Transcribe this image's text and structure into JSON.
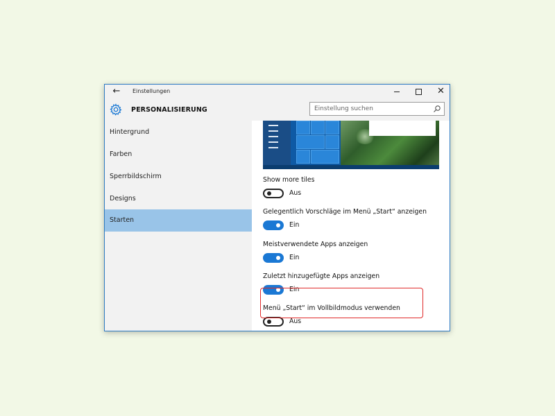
{
  "window": {
    "title": "Einstellungen"
  },
  "header": {
    "section_title": "PERSONALISIERUNG",
    "search_placeholder": "Einstellung suchen"
  },
  "sidebar": {
    "items": [
      {
        "label": "Hintergrund",
        "active": false
      },
      {
        "label": "Farben",
        "active": false
      },
      {
        "label": "Sperrbildschirm",
        "active": false
      },
      {
        "label": "Designs",
        "active": false
      },
      {
        "label": "Starten",
        "active": true
      }
    ]
  },
  "settings": [
    {
      "label": "Show more tiles",
      "state": "Aus",
      "on": false
    },
    {
      "label": "Gelegentlich Vorschläge im Menü „Start“ anzeigen",
      "state": "Ein",
      "on": true,
      "highlighted": true
    },
    {
      "label": "Meistverwendete Apps anzeigen",
      "state": "Ein",
      "on": true
    },
    {
      "label": "Zuletzt hinzugefügte Apps anzeigen",
      "state": "Ein",
      "on": true
    },
    {
      "label": "Menü „Start“ im Vollbildmodus verwenden",
      "state": "Aus",
      "on": false
    }
  ],
  "colors": {
    "accent": "#1a78d4",
    "nav_active": "#99c4e8",
    "highlight_border": "#e02a2a",
    "window_border": "#2b79c2"
  },
  "icons": {
    "back": "back-arrow-icon",
    "settings": "gear-icon",
    "search": "search-icon",
    "minimize": "minimize-icon",
    "maximize": "maximize-icon",
    "close": "close-icon"
  }
}
